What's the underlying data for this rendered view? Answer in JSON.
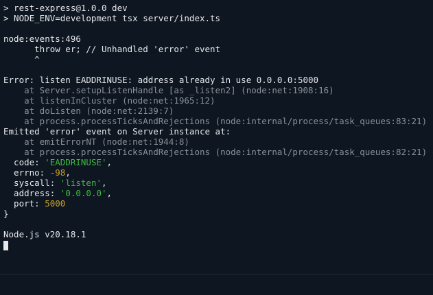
{
  "terminal": {
    "cmd_line_1": "> rest-express@1.0.0 dev",
    "cmd_line_2": "> NODE_ENV=development tsx server/index.ts",
    "events_line": "node:events:496",
    "throw_line": "      throw er; // Unhandled 'error' event",
    "caret_line": "      ^",
    "error_line": "Error: listen EADDRINUSE: address already in use 0.0.0.0:5000",
    "stack": [
      "    at Server.setupListenHandle [as _listen2] (node:net:1908:16)",
      "    at listenInCluster (node:net:1965:12)",
      "    at doListen (node:net:2139:7)",
      "    at process.processTicksAndRejections (node:internal/process/task_queues:83:21)"
    ],
    "emitted_line": "Emitted 'error' event on Server instance at:",
    "stack2": [
      "    at emitErrorNT (node:net:1944:8)",
      "    at process.processTicksAndRejections (node:internal/process/task_queues:82:21)"
    ],
    "brace_open": " {",
    "props": {
      "code_key": "  code: ",
      "code_val": "'EADDRINUSE'",
      "errno_key": "  errno: ",
      "errno_val": "-98",
      "syscall_key": "  syscall: ",
      "syscall_val": "'listen'",
      "address_key": "  address: ",
      "address_val": "'0.0.0.0'",
      "port_key": "  port: ",
      "port_val": "5000",
      "comma": ","
    },
    "brace_close": "}",
    "node_version": "Node.js v20.18.1"
  }
}
